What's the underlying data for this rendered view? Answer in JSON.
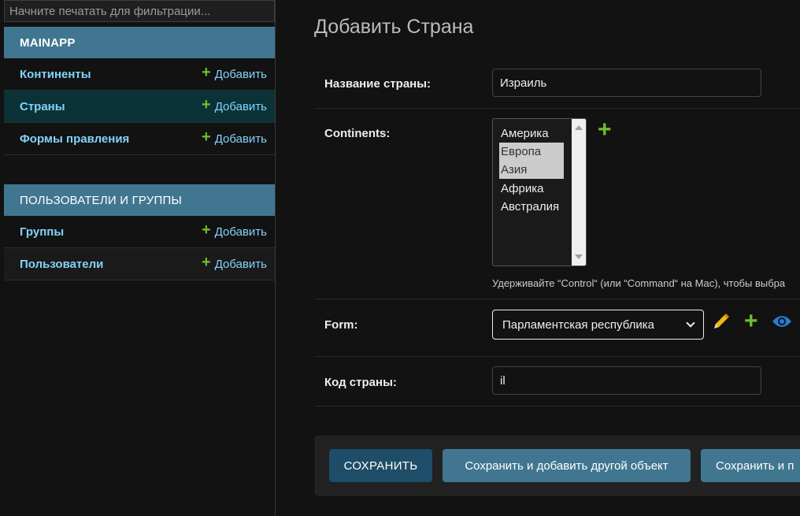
{
  "sidebar": {
    "filter_placeholder": "Начните печатать для фильтрации...",
    "modules": [
      {
        "title": "MAINAPP",
        "models": [
          {
            "name": "Континенты",
            "add": "Добавить"
          },
          {
            "name": "Страны",
            "add": "Добавить"
          },
          {
            "name": "Формы правления",
            "add": "Добавить"
          }
        ]
      },
      {
        "title": "ПОЛЬЗОВАТЕЛИ И ГРУППЫ",
        "models": [
          {
            "name": "Группы",
            "add": "Добавить"
          },
          {
            "name": "Пользователи",
            "add": "Добавить"
          }
        ]
      }
    ]
  },
  "main": {
    "title": "Добавить Страна",
    "fields": {
      "name": {
        "label": "Название страны:",
        "value": "Израиль"
      },
      "continents": {
        "label": "Continents:",
        "options": [
          "Америка",
          "Европа",
          "Азия",
          "Африка",
          "Австралия"
        ],
        "selected": [
          "Европа",
          "Азия"
        ],
        "help": "Удерживайте “Control“ (или “Command“ на Mac), чтобы выбра"
      },
      "form": {
        "label": "Form:",
        "value": "Парламентская республика"
      },
      "code": {
        "label": "Код страны:",
        "value": "il"
      }
    },
    "buttons": {
      "save": "СОХРАНИТЬ",
      "save_add_another": "Сохранить и добавить другой объект",
      "save_continue": "Сохранить и п"
    }
  },
  "colors": {
    "module_header": "#417690",
    "active_row": "#0b3237",
    "link": "#81d4fa",
    "add_green": "#70bf2b",
    "save_button": "#1d4d68"
  },
  "icons": {
    "add": "plus-icon",
    "change": "pencil-icon",
    "view": "eye-icon",
    "dropdown": "chevron-down-icon"
  }
}
